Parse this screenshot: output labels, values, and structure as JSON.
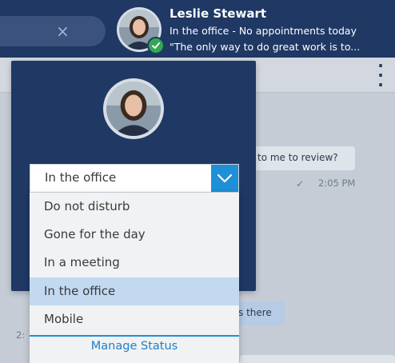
{
  "header": {
    "user_name": "Leslie Stewart",
    "status_line": "In the office - No appointments today",
    "quote_line": "\"The only way to do great work is to..."
  },
  "search": {
    "clear_icon": "×"
  },
  "chat": {
    "message_1": "to me to review?",
    "message_1_time": "2:05 PM",
    "message_2": "s there",
    "partial_time": "2:"
  },
  "status_select": {
    "selected": "In the office",
    "options": [
      {
        "label": "Do not disturb"
      },
      {
        "label": "Gone for the day"
      },
      {
        "label": "In a meeting"
      },
      {
        "label": "In the office"
      },
      {
        "label": "Mobile"
      }
    ],
    "selected_option_index": 3,
    "manage_label": "Manage Status"
  },
  "colors": {
    "header_bg": "#1f3864",
    "accent_blue": "#1e90d8",
    "selected_option_bg": "#c2d9f0",
    "status_green": "#33a853"
  }
}
